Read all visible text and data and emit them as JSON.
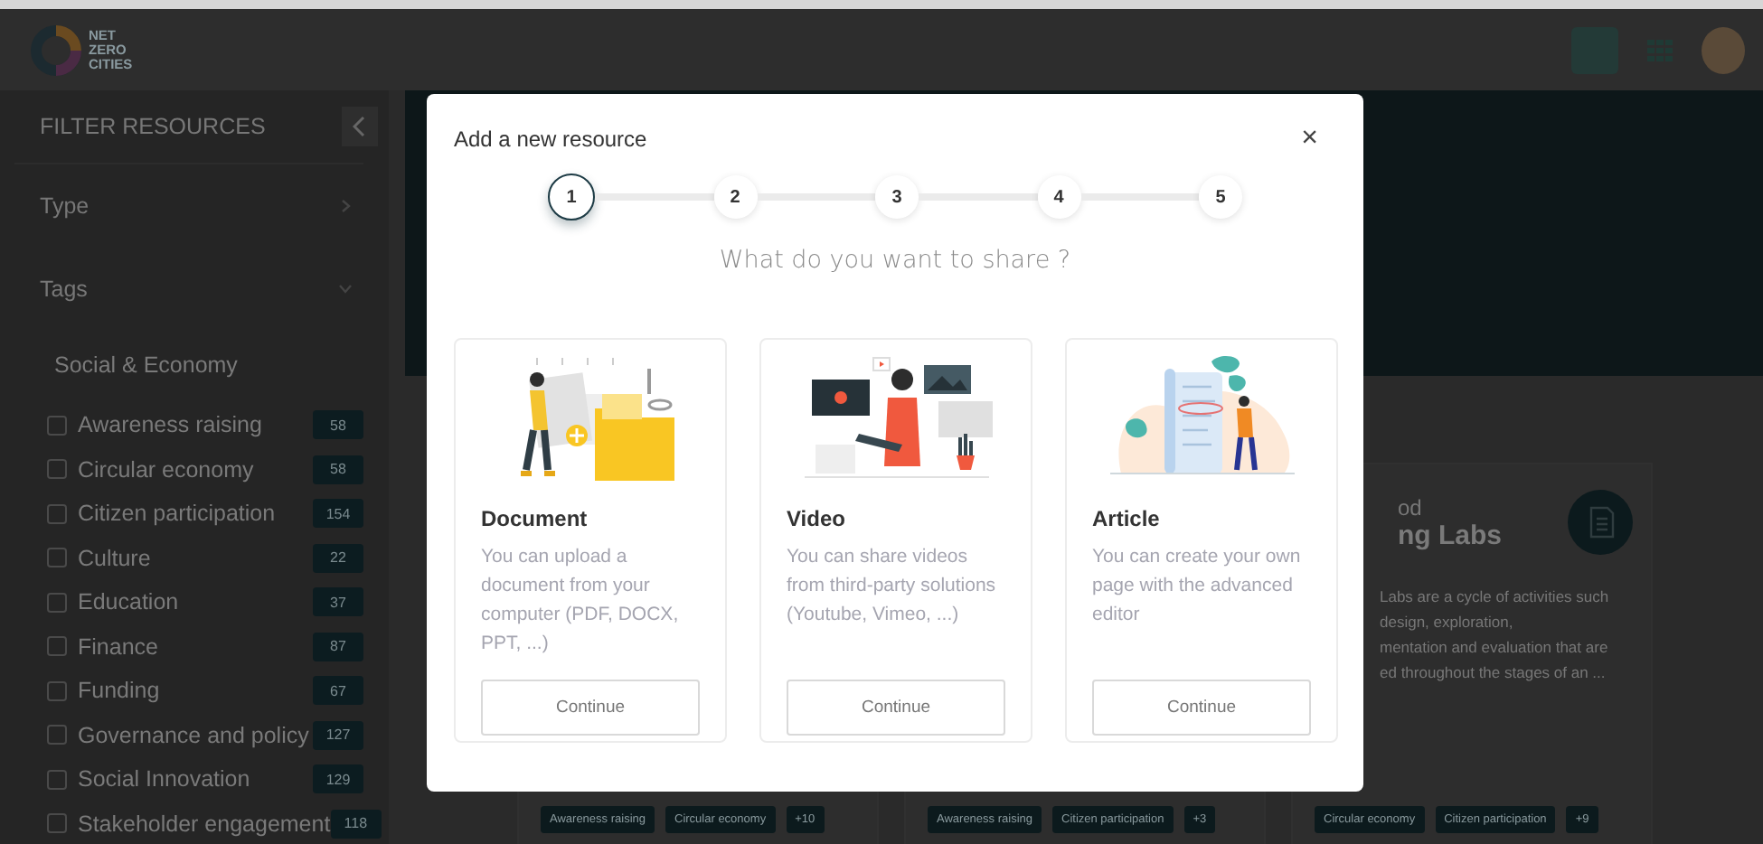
{
  "header": {
    "logo_lines": [
      "NET",
      "ZERO",
      "CITIES"
    ]
  },
  "sidebar": {
    "title": "FILTER RESOURCES",
    "sections": [
      {
        "label": "Type",
        "expanded": false
      },
      {
        "label": "Tags",
        "expanded": true
      }
    ],
    "group": "Social & Economy",
    "tags": [
      {
        "label": "Awareness raising",
        "count": "58",
        "checked": false
      },
      {
        "label": "Circular economy",
        "count": "58",
        "checked": false
      },
      {
        "label": "Citizen participation",
        "count": "154",
        "checked": false
      },
      {
        "label": "Culture",
        "count": "22",
        "checked": false
      },
      {
        "label": "Education",
        "count": "37",
        "checked": false
      },
      {
        "label": "Finance",
        "count": "87",
        "checked": false
      },
      {
        "label": "Funding",
        "count": "67",
        "checked": false
      },
      {
        "label": "Governance and policy",
        "count": "127",
        "checked": false
      },
      {
        "label": "Social Innovation",
        "count": "129",
        "checked": false
      },
      {
        "label": "Stakeholder engagement",
        "count": "118",
        "checked": false
      }
    ]
  },
  "resource_cards": [
    {
      "tags": [
        "Awareness raising",
        "Circular economy",
        "+10"
      ]
    },
    {
      "tags": [
        "Awareness raising",
        "Citizen participation",
        "+3"
      ]
    },
    {
      "type_fragment": "od",
      "title_fragment": "ng Labs",
      "description_lines": [
        "Labs are a cycle of activities such",
        "design, exploration,",
        "mentation and evaluation that are",
        "ed throughout the stages of an ..."
      ],
      "tags": [
        "Circular economy",
        "Citizen participation",
        "+9"
      ]
    }
  ],
  "modal": {
    "title": "Add a new resource",
    "close": "×",
    "steps": [
      {
        "label": "1",
        "selected": true
      },
      {
        "label": "2",
        "selected": false
      },
      {
        "label": "3",
        "selected": false
      },
      {
        "label": "4",
        "selected": false
      },
      {
        "label": "5",
        "selected": false
      }
    ],
    "question": "What do you want to share ?",
    "options": [
      {
        "kind": "document",
        "title": "Document",
        "description": "You can upload a document from your computer (PDF, DOCX, PPT, ...)",
        "button": "Continue"
      },
      {
        "kind": "video",
        "title": "Video",
        "description": "You can share videos from third-party solutions (Youtube, Vimeo, ...)",
        "button": "Continue"
      },
      {
        "kind": "article",
        "title": "Article",
        "description": "You can create your own page with the advanced editor",
        "button": "Continue"
      }
    ]
  }
}
